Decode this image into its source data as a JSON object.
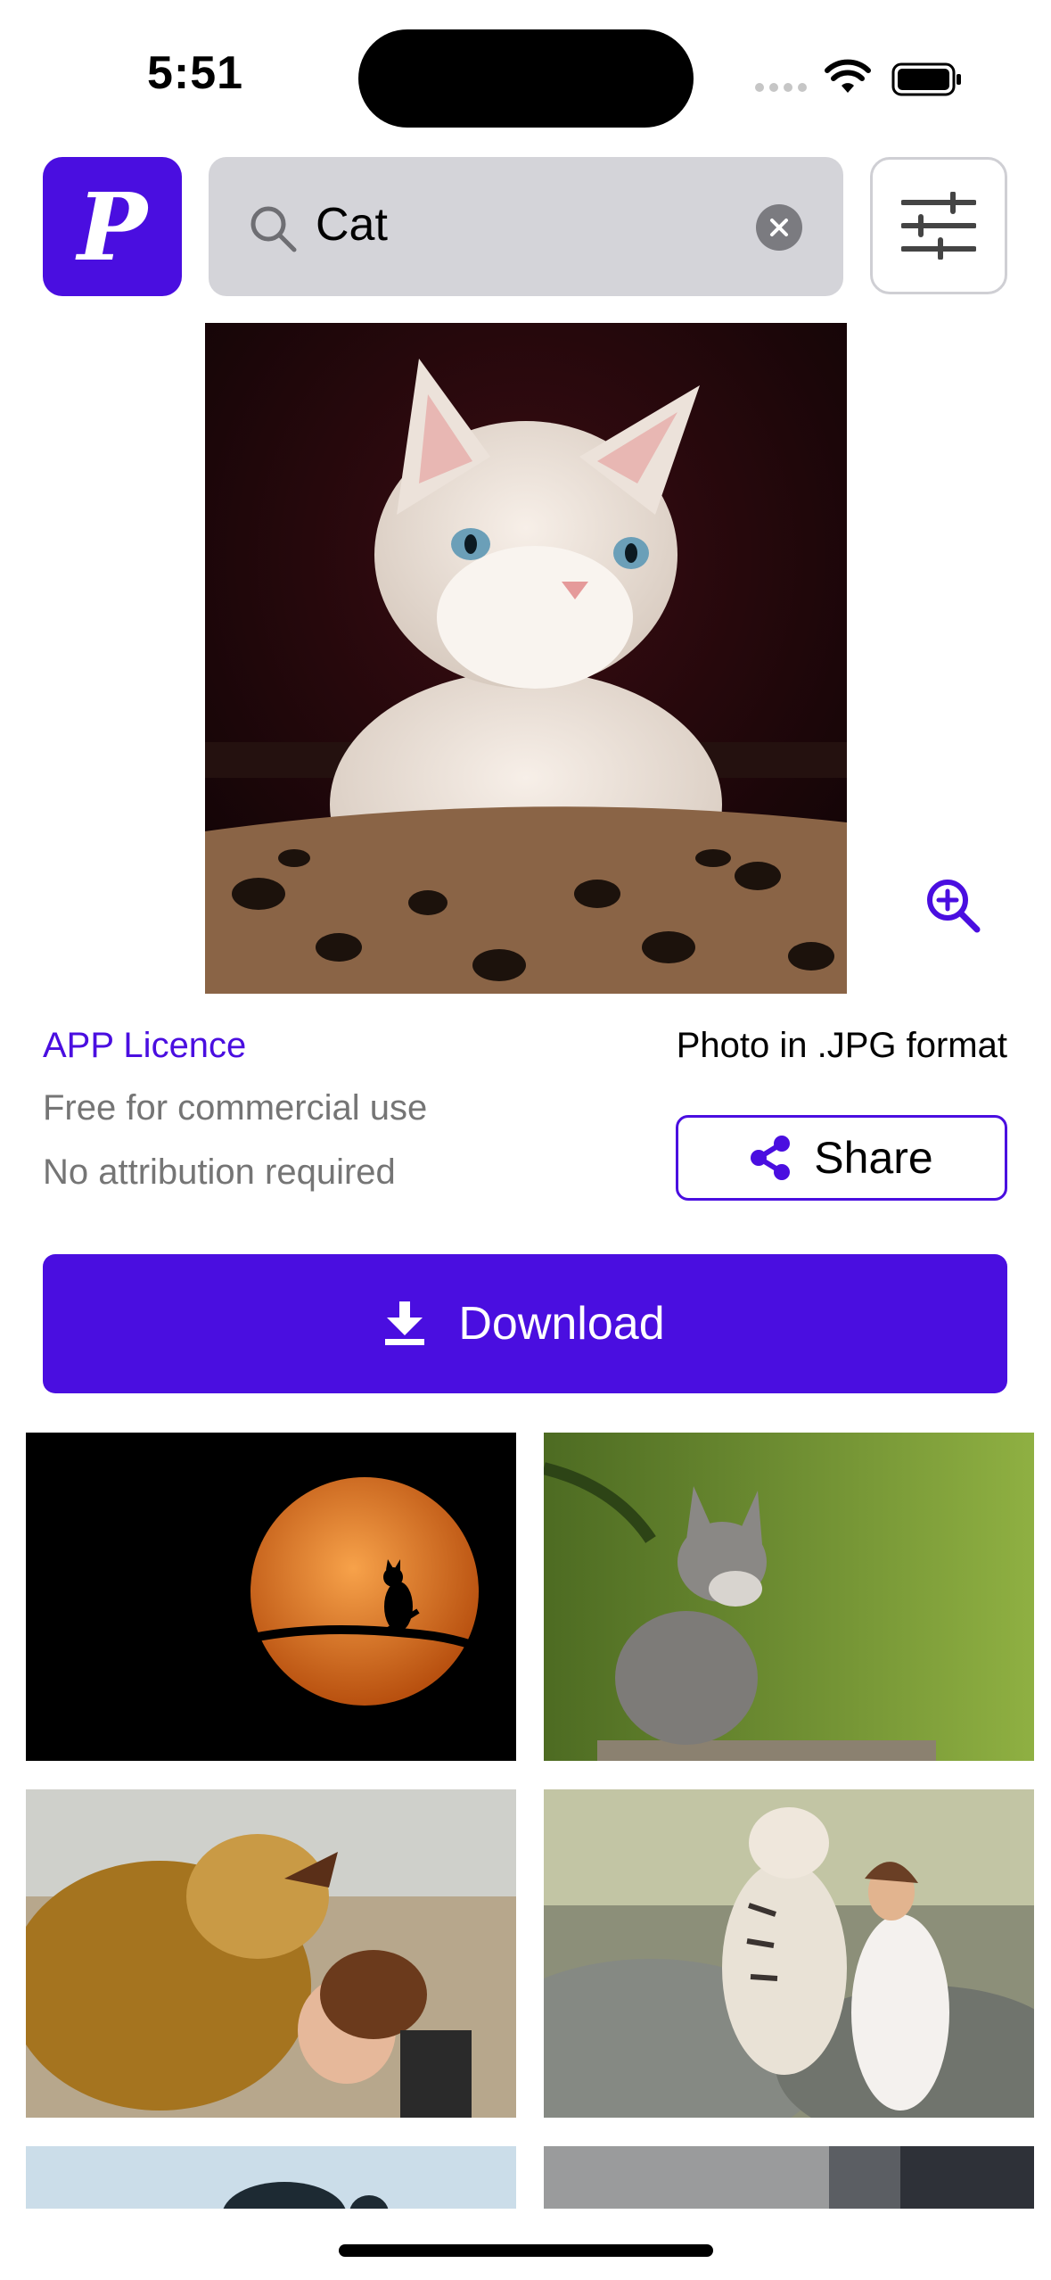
{
  "status_bar": {
    "time": "5:51"
  },
  "header": {
    "logo_letter": "P",
    "search": {
      "value": "Cat",
      "placeholder": ""
    }
  },
  "photo": {
    "subject": "cat"
  },
  "info": {
    "licence": "APP Licence",
    "format": "Photo in .JPG format",
    "line1": "Free for commercial use",
    "line2": "No attribution required",
    "share_label": "Share"
  },
  "actions": {
    "download_label": "Download"
  },
  "grid": [
    {
      "name": "moon-cat"
    },
    {
      "name": "gray-kitten"
    },
    {
      "name": "lion-girl"
    },
    {
      "name": "tiger-woman"
    },
    {
      "name": "partial-blue"
    },
    {
      "name": "partial-gray"
    }
  ],
  "colors": {
    "accent": "#4a0ee0",
    "search_bg": "#d4d4d9",
    "muted_text": "#757575"
  }
}
